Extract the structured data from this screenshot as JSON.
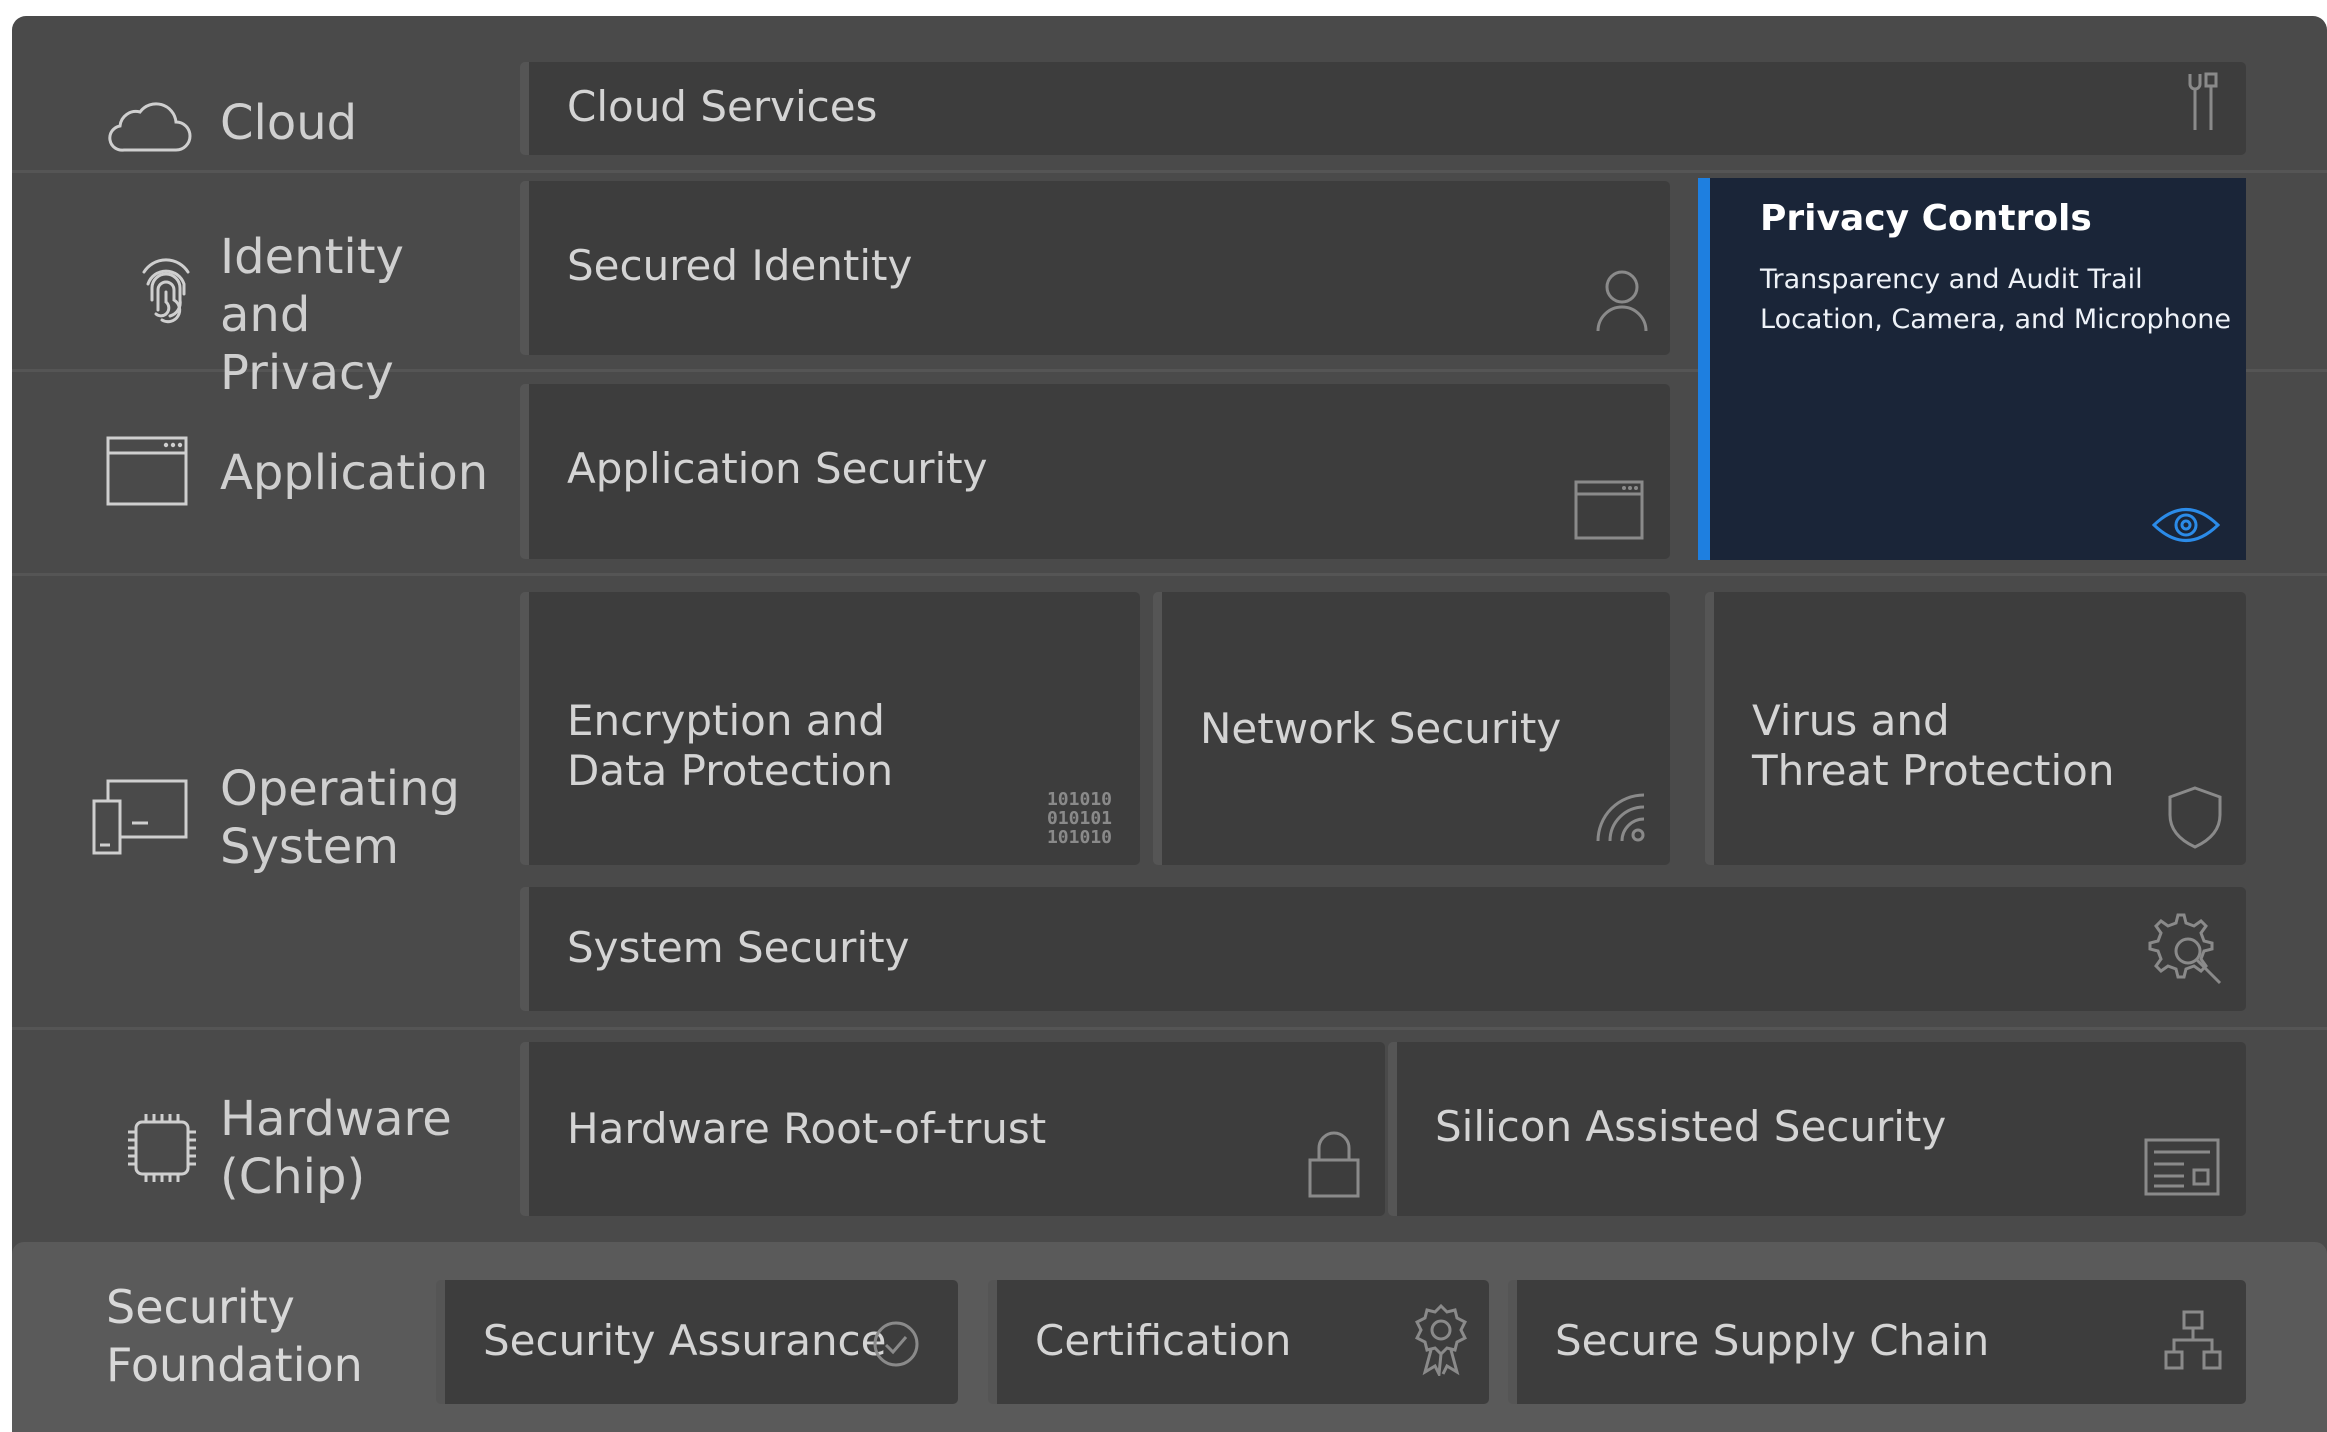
{
  "layers": {
    "cloud": "Cloud",
    "identity": "Identity and\nPrivacy",
    "application": "Application",
    "os": "Operating\nSystem",
    "hardware": "Hardware\n(Chip)",
    "foundation": "Security\nFoundation"
  },
  "tiles": {
    "cloud_services": "Cloud Services",
    "secured_identity": "Secured Identity",
    "application_security": "Application Security",
    "encryption": "Encryption and\nData Protection",
    "network_security": "Network Security",
    "virus_threat": "Virus and\nThreat Protection",
    "system_security": "System Security",
    "hardware_root": "Hardware Root-of-trust",
    "silicon_security": "Silicon Assisted Security",
    "security_assurance": "Security Assurance",
    "certification": "Certification",
    "secure_supply_chain": "Secure Supply Chain"
  },
  "privacy": {
    "title": "Privacy Controls",
    "line1": "Transparency and Audit Trail",
    "line2": "Location, Camera, and Microphone"
  },
  "binary_text": {
    "row1": "101010",
    "row2": "010101",
    "row3": "101010"
  },
  "icons": {
    "cloud": "cloud-icon",
    "identity": "fingerprint-icon",
    "application": "app-window-icon",
    "os": "devices-icon",
    "hardware": "chip-icon",
    "cloud_services": "tools-icon",
    "secured_identity": "person-icon",
    "application_security": "window-icon",
    "encryption": "binary-icon",
    "network_security": "wifi-icon",
    "virus_threat": "shield-icon",
    "system_security": "gear-search-icon",
    "hardware_root": "lock-icon",
    "silicon_security": "circuit-board-icon",
    "security_assurance": "check-circle-icon",
    "certification": "ribbon-badge-icon",
    "secure_supply_chain": "hierarchy-icon",
    "privacy": "eye-icon"
  },
  "colors": {
    "background": "#4a4a4a",
    "tile": "#3d3d3d",
    "privacy_bg": "#1a2538",
    "accent": "#1e7fe0"
  }
}
